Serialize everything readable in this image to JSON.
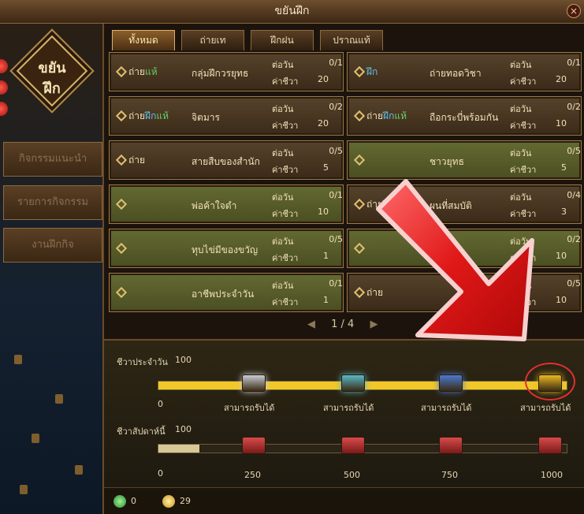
{
  "window": {
    "title": "ขยันฝึก",
    "close_label": "×"
  },
  "left": {
    "emblem_line1": "ขยัน",
    "emblem_line2": "ฝึก",
    "buttons": [
      {
        "label": "กิจกรรมแนะนำ"
      },
      {
        "label": "รายการกิจกรรม"
      },
      {
        "label": "งานฝึกกิจ"
      }
    ]
  },
  "tabs": [
    {
      "label": "ทั้งหมด"
    },
    {
      "label": "ถ่ายเท"
    },
    {
      "label": "ฝึกฝน"
    },
    {
      "label": "ปราณแท้"
    }
  ],
  "tasks": [
    {
      "tags": [
        {
          "t": "ถ่าย",
          "c": "t1"
        },
        {
          "t": "แห้",
          "c": "t3"
        }
      ],
      "name": "กลุ่มฝึกวรยุทธ",
      "per_day": "0/1",
      "life": "20",
      "green": false
    },
    {
      "tags": [
        {
          "t": "ฝึก",
          "c": "t2"
        }
      ],
      "name": "ถ่ายทอดวิชา",
      "per_day": "0/1",
      "life": "20",
      "green": false
    },
    {
      "tags": [
        {
          "t": "ถ่าย",
          "c": "t1"
        },
        {
          "t": "ฝึก",
          "c": "t2"
        },
        {
          "t": "แห้",
          "c": "t3"
        }
      ],
      "name": "จิตมาร",
      "per_day": "0/2",
      "life": "20",
      "green": false
    },
    {
      "tags": [
        {
          "t": "ถ่าย",
          "c": "t1"
        },
        {
          "t": "ฝึก",
          "c": "t2"
        },
        {
          "t": "แห้",
          "c": "t3"
        }
      ],
      "name": "ถือกระบี่พร้อมกัน",
      "per_day": "0/2",
      "life": "10",
      "green": false
    },
    {
      "tags": [
        {
          "t": "ถ่าย",
          "c": "t1"
        }
      ],
      "name": "สายสืบของสำนัก",
      "per_day": "0/5",
      "life": "5",
      "green": false
    },
    {
      "tags": [],
      "name": "ชาวยุทธ",
      "per_day": "0/5",
      "life": "5",
      "green": true
    },
    {
      "tags": [],
      "name": "พ่อค้าใจดำ",
      "per_day": "0/1",
      "life": "10",
      "green": true
    },
    {
      "tags": [
        {
          "t": "ถ่าย",
          "c": "t1"
        },
        {
          "t": "ฝึก",
          "c": "t2"
        },
        {
          "t": "แห้",
          "c": "t3"
        }
      ],
      "name": "ผนที่สมบัติ",
      "per_day": "0/4",
      "life": "3",
      "green": false
    },
    {
      "tags": [],
      "name": "ทุบไข่มีของขวัญ",
      "per_day": "0/5",
      "life": "1",
      "green": true
    },
    {
      "tags": [],
      "name": "",
      "per_day": "0/2",
      "life": "10",
      "green": true
    },
    {
      "tags": [],
      "name": "อาชีพประจำวัน",
      "per_day": "0/1",
      "life": "1",
      "green": true
    },
    {
      "tags": [
        {
          "t": "ถ่าย",
          "c": "t1"
        }
      ],
      "name": "",
      "per_day": "0/5",
      "life": "10",
      "green": false
    }
  ],
  "labels": {
    "per_day": "ต่อวัน",
    "life": "ค่าชีวา"
  },
  "pager": {
    "text": "1 / 4",
    "prev": "◀",
    "next": "▶"
  },
  "daily": {
    "title": "ชีวาประจำวัน",
    "max": "100",
    "start": "0",
    "progress_fraction": 1.0,
    "chests": [
      {
        "label": "สามารถรับได้",
        "color": "#c8ccd4"
      },
      {
        "label": "สามารถรับได้",
        "color": "#5ab8c8"
      },
      {
        "label": "สามารถรับได้",
        "color": "#4a7ad0"
      },
      {
        "label": "สามารถรับได้",
        "color": "#e8b820"
      }
    ]
  },
  "weekly": {
    "title": "ชีวาสัปดาห์นี้",
    "max": "100",
    "start": "0",
    "progress_fraction": 0.1,
    "chests": [
      {
        "label": "250"
      },
      {
        "label": "500"
      },
      {
        "label": "750"
      },
      {
        "label": "1000"
      }
    ]
  },
  "currency": {
    "green_coin": "0",
    "gold_coin": "29"
  },
  "colors": {
    "accent": "#d9b06a",
    "arrow": "#d81818",
    "circle": "#e03030",
    "bar_gold": "#f0c828"
  }
}
